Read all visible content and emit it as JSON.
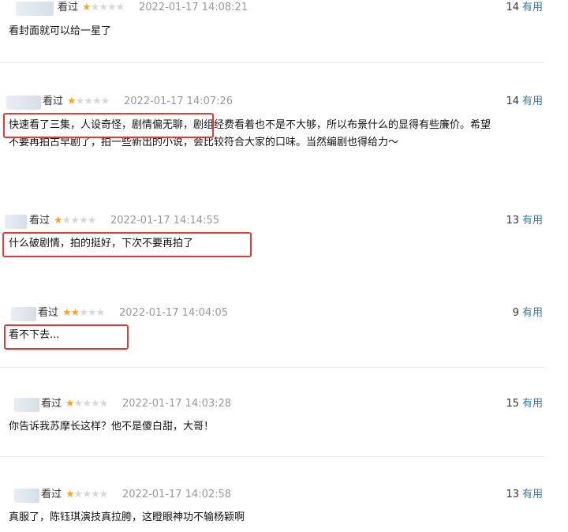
{
  "reviews": [
    {
      "status": "看过",
      "stars_display": "★★★★★",
      "rating": 1,
      "date": "2022-01-17 14:08:21",
      "useful_count": "14",
      "useful_label": "有用",
      "content": "看封面就可以给一星了"
    },
    {
      "status": "看过",
      "stars_display": "★★★★★",
      "rating": 1,
      "date": "2022-01-17 14:07:26",
      "useful_count": "14",
      "useful_label": "有用",
      "content_line1": "快速看了三集，人设奇怪，剧情偏无聊，剧组经费看着也不是不大够，所以布景什么的显得有些廉价。希望",
      "content_line2": "不要再拍古早剧了，拍一些新出的小说，会比较符合大家的口味。当然编剧也得给力～"
    },
    {
      "status": "看过",
      "stars_display": "★★★★★",
      "rating": 1,
      "date": "2022-01-17 14:14:55",
      "useful_count": "13",
      "useful_label": "有用",
      "content": "什么破剧情，拍的挺好，下次不要再拍了"
    },
    {
      "status": "看过",
      "stars_display": "★★★★★",
      "rating": 2,
      "date": "2022-01-17 14:04:05",
      "useful_count": "9",
      "useful_label": "有用",
      "content": "看不下去..."
    },
    {
      "status": "看过",
      "stars_display": "★★★★★",
      "rating": 1,
      "date": "2022-01-17 14:03:28",
      "useful_count": "15",
      "useful_label": "有用",
      "content": "你告诉我苏摩长这样？他不是傻白甜，大哥！"
    },
    {
      "status": "看过",
      "stars_display": "★★★★★",
      "rating": 1,
      "date": "2022-01-17 14:02:58",
      "useful_count": "13",
      "useful_label": "有用",
      "content": "真服了，陈钰琪演技真拉胯，这瞪眼神功不输杨颖啊"
    }
  ],
  "colors": {
    "star_on": "#f5a623",
    "star_off": "#d7d7d7",
    "link": "#3377aa",
    "highlight": "#e53935",
    "date": "#999999"
  }
}
